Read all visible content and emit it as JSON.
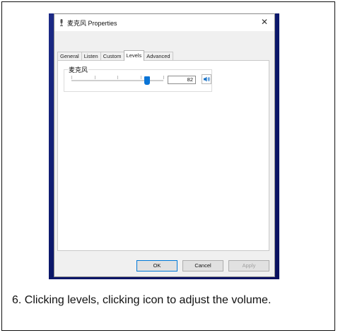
{
  "dialog": {
    "title": "麦克风 Properties",
    "close_glyph": "✕",
    "tabs": [
      {
        "label": "General",
        "active": false
      },
      {
        "label": "Listen",
        "active": false
      },
      {
        "label": "Custom",
        "active": false
      },
      {
        "label": "Levels",
        "active": true
      },
      {
        "label": "Advanced",
        "active": false
      }
    ],
    "levels": {
      "device_label": "麦克风",
      "level_value": "82",
      "level_fraction": 0.82
    },
    "buttons": {
      "ok": "OK",
      "cancel": "Cancel",
      "apply": "Apply"
    }
  },
  "caption": "6. Clicking levels, clicking icon to adjust the volume.",
  "colors": {
    "accent": "#0a74d6",
    "desktop": "#0a1668"
  },
  "icons": {
    "window_icon": "microphone-icon",
    "speaker": "speaker-icon"
  }
}
